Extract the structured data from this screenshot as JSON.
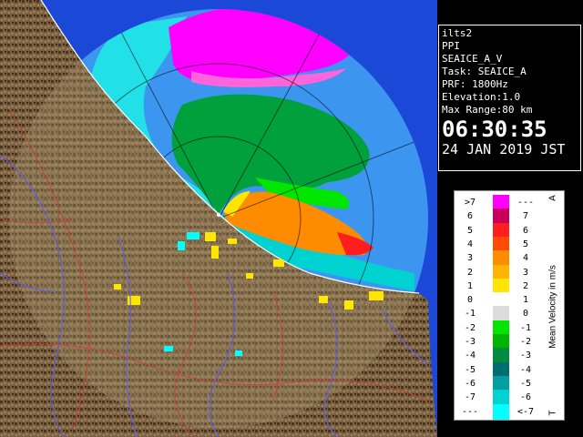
{
  "info": {
    "site": "ilts2",
    "scan_type": "PPI",
    "scan_name": "SEAICE_A_V",
    "task": "Task: SEAICE_A",
    "prf": "PRF: 1800Hz",
    "elevation": "Elevation:1.0",
    "max_range": "Max Range:80 km",
    "time": "06:30:35",
    "date": "24 JAN 2019 JST"
  },
  "legend": {
    "title": "Mean Velocity in m/s",
    "top_marker": "A",
    "bottom_marker": "T",
    "rows": [
      {
        "left": ">7",
        "right": "---",
        "color": "#ff00ff"
      },
      {
        "left": "6",
        "right": "7",
        "color": "#c8005a"
      },
      {
        "left": "5",
        "right": "6",
        "color": "#ff1e1e"
      },
      {
        "left": "4",
        "right": "5",
        "color": "#ff4b00"
      },
      {
        "left": "3",
        "right": "4",
        "color": "#ff8c00"
      },
      {
        "left": "2",
        "right": "3",
        "color": "#ffb400"
      },
      {
        "left": "1",
        "right": "2",
        "color": "#ffe600"
      },
      {
        "left": "0",
        "right": "1",
        "color": "#ffffff"
      },
      {
        "left": "-1",
        "right": "0",
        "color": "#dcdcdc"
      },
      {
        "left": "-2",
        "right": "-1",
        "color": "#00e600"
      },
      {
        "left": "-3",
        "right": "-2",
        "color": "#00b400"
      },
      {
        "left": "-4",
        "right": "-3",
        "color": "#008c3c"
      },
      {
        "left": "-5",
        "right": "-4",
        "color": "#006e6e"
      },
      {
        "left": "-6",
        "right": "-5",
        "color": "#00a0a0"
      },
      {
        "left": "-7",
        "right": "-6",
        "color": "#00d2d2"
      },
      {
        "left": "---",
        "right": "<-7",
        "color": "#00ffff"
      }
    ]
  },
  "colors": {
    "sea": "#1c48d8",
    "range_disc": "#3c96f0",
    "land": "#7a6040",
    "land_dark": "#3e2c18",
    "rivers": "#5a5aff",
    "roads": "#e23030"
  },
  "icons": [
    "range-ring-icon",
    "coastline-icon"
  ]
}
